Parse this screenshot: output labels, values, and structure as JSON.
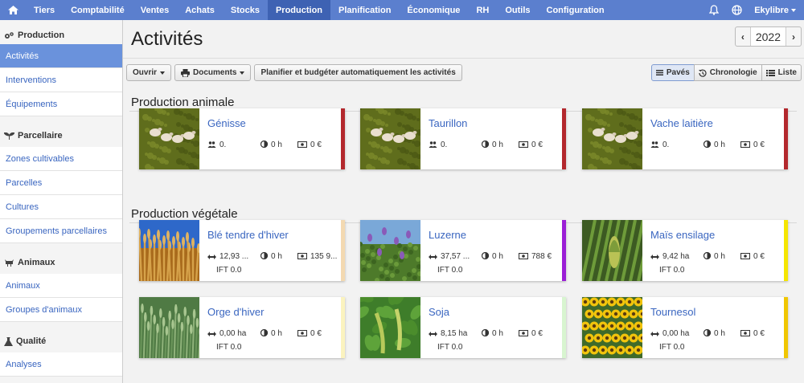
{
  "topnav": {
    "items": [
      "Tiers",
      "Comptabilité",
      "Ventes",
      "Achats",
      "Stocks",
      "Production",
      "Planification",
      "Économique",
      "RH",
      "Outils",
      "Configuration"
    ],
    "active_index": 5,
    "user": "Ekylibre"
  },
  "sidebar": {
    "sections": [
      {
        "title": "Production",
        "items": [
          "Activités",
          "Interventions",
          "Équipements"
        ]
      },
      {
        "title": "Parcellaire",
        "items": [
          "Zones cultivables",
          "Parcelles",
          "Cultures",
          "Groupements parcellaires"
        ]
      },
      {
        "title": "Animaux",
        "items": [
          "Animaux",
          "Groupes d'animaux"
        ]
      },
      {
        "title": "Qualité",
        "items": [
          "Analyses"
        ]
      }
    ]
  },
  "page": {
    "title": "Activités",
    "year": "2022",
    "prev": "‹",
    "next": "›"
  },
  "toolbar": {
    "open_label": "Ouvrir",
    "documents_label": "Documents",
    "plan_label": "Planifier et budgéter automatiquement les activités",
    "view_tiles": "Pavés",
    "view_timeline": "Chronologie",
    "view_list": "Liste"
  },
  "sections": {
    "animal": "Production animale",
    "vegetal": "Production végétale"
  },
  "cards": {
    "genisse": {
      "name": "Génisse",
      "count": "0.",
      "hours": "0 h",
      "cost": "0 €",
      "color": "#b3282d"
    },
    "taurillon": {
      "name": "Taurillon",
      "count": "0.",
      "hours": "0 h",
      "cost": "0 €",
      "color": "#b3282d"
    },
    "vache": {
      "name": "Vache laitière",
      "count": "0.",
      "hours": "0 h",
      "cost": "0 €",
      "color": "#b3282d"
    },
    "ble": {
      "name": "Blé tendre d'hiver",
      "area": "12,93 ...",
      "hours": "0 h",
      "cost": "135 9...",
      "ift": "IFT 0.0",
      "color": "#f3d9b1"
    },
    "luzerne": {
      "name": "Luzerne",
      "area": "37,57 ...",
      "hours": "0 h",
      "cost": "788 €",
      "ift": "IFT 0.0",
      "color": "#9b1fd6"
    },
    "mais": {
      "name": "Maïs ensilage",
      "area": "9,42 ha",
      "hours": "0 h",
      "cost": "0 €",
      "ift": "IFT 0.0",
      "color": "#f5e500"
    },
    "orge": {
      "name": "Orge d'hiver",
      "area": "0,00 ha",
      "hours": "0 h",
      "cost": "0 €",
      "ift": "IFT 0.0",
      "color": "#fbf3bf"
    },
    "soja": {
      "name": "Soja",
      "area": "8,15 ha",
      "hours": "0 h",
      "cost": "0 €",
      "ift": "IFT 0.0",
      "color": "#d8f5d0"
    },
    "tournesol": {
      "name": "Tournesol",
      "area": "0,00 ha",
      "hours": "0 h",
      "cost": "0 €",
      "ift": "IFT 0.0",
      "color": "#f0c600"
    }
  },
  "icons": [
    "home-icon",
    "bell-icon",
    "globe-icon",
    "cogs-icon",
    "seedling-icon",
    "cow-icon",
    "flask-icon",
    "print-icon",
    "history-icon",
    "list-icon",
    "users-icon",
    "clock-icon",
    "money-icon",
    "resize-icon"
  ]
}
